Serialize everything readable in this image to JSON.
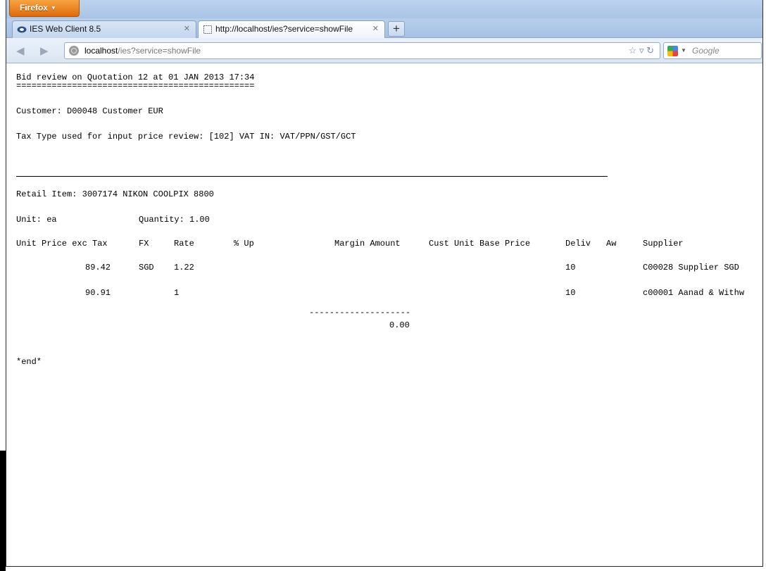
{
  "browser": {
    "menu_button": "Firefox",
    "tabs": [
      {
        "label": "IES Web Client 8.5"
      },
      {
        "label": "http://localhost/ies?service=showFile"
      }
    ],
    "url_host": "localhost",
    "url_path": "/ies?service=showFile",
    "search_placeholder": "Google"
  },
  "report": {
    "title": "Bid review on Quotation 12 at 01 JAN 2013 17:34",
    "title_underline": "===============================================",
    "customer": "Customer: D00048 Customer EUR",
    "tax_type": "Tax Type used for input price review: [102] VAT IN: VAT/PPN/GST/GCT",
    "retail_item": "Retail Item: 3007174 NIKON COOLPIX 8800",
    "unit": "Unit: ea",
    "quantity": "Quantity: 1.00",
    "columns": [
      "Unit Price exc Tax",
      "FX",
      "Rate",
      "% Up",
      "Margin Amount",
      "Cust Unit Base Price",
      "Deliv",
      "Aw",
      "Supplier"
    ],
    "rows": [
      {
        "price": "89.42",
        "fx": "SGD",
        "rate": "1.22",
        "deliv": "10",
        "supplier": "C00028 Supplier SGD"
      },
      {
        "price": "90.91",
        "fx": "",
        "rate": "1",
        "deliv": "10",
        "supplier": "c00001 Aanad & Withw"
      }
    ],
    "total_rule": "--------------------",
    "total": "0.00",
    "end_marker": "*end*"
  }
}
